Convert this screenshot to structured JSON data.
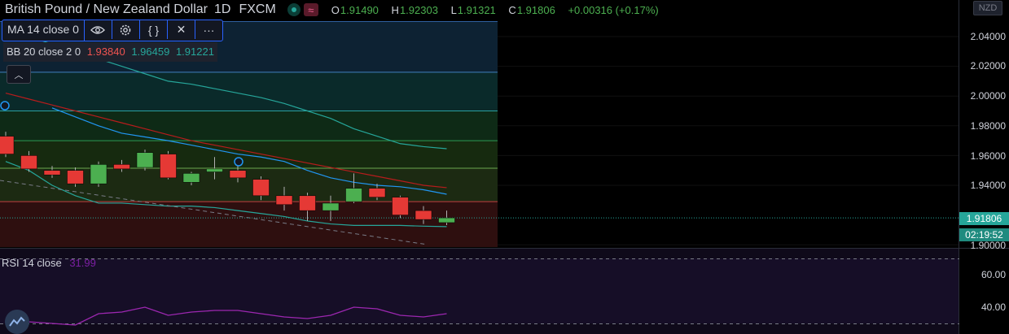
{
  "header": {
    "symbol": "British Pound / New Zealand Dollar",
    "timeframe": "1D",
    "exchange": "FXCM",
    "open_key": "O",
    "open": "1.91490",
    "high_key": "H",
    "high": "1.92303",
    "low_key": "L",
    "low": "1.91321",
    "close_key": "C",
    "close": "1.91806",
    "change": "+0.00316 (+0.17%)"
  },
  "indicators": {
    "ma_label": "MA 14 close 0",
    "bb_label": "BB 20 close 2 0",
    "bb_basis": "1.93840",
    "bb_upper": "1.96459",
    "bb_lower": "1.91221",
    "rsi_label": "RSI 14 close",
    "rsi_value": "31.99"
  },
  "toolbar_icons": [
    "eye-icon",
    "gear-icon",
    "braces-icon",
    "close-icon",
    "more-icon"
  ],
  "currency": "NZD",
  "price_axis": [
    "2.04000",
    "2.02000",
    "2.00000",
    "1.98000",
    "1.96000",
    "1.94000",
    "1.90000"
  ],
  "current_price": "1.91806",
  "countdown": "02:19:52",
  "rsi_axis": [
    "60.00",
    "40.00"
  ],
  "colors": {
    "up": "#4caf50",
    "down": "#e53935",
    "accent": "#2962ff",
    "ma": "#2196f3",
    "bb_basis": "#b71c1c",
    "bb_band": "#26a69a",
    "rsi": "#9c27b0"
  },
  "chart_data": {
    "type": "candlestick",
    "ylim": [
      1.9,
      2.05
    ],
    "candles": [
      {
        "o": 1.973,
        "h": 1.976,
        "l": 1.959,
        "c": 1.961
      },
      {
        "o": 1.96,
        "h": 1.963,
        "l": 1.949,
        "c": 1.951
      },
      {
        "o": 1.95,
        "h": 1.953,
        "l": 1.945,
        "c": 1.947
      },
      {
        "o": 1.95,
        "h": 1.952,
        "l": 1.939,
        "c": 1.941
      },
      {
        "o": 1.941,
        "h": 1.956,
        "l": 1.939,
        "c": 1.954
      },
      {
        "o": 1.954,
        "h": 1.957,
        "l": 1.949,
        "c": 1.951
      },
      {
        "o": 1.952,
        "h": 1.964,
        "l": 1.95,
        "c": 1.962
      },
      {
        "o": 1.961,
        "h": 1.963,
        "l": 1.944,
        "c": 1.945
      },
      {
        "o": 1.942,
        "h": 1.949,
        "l": 1.94,
        "c": 1.948
      },
      {
        "o": 1.949,
        "h": 1.959,
        "l": 1.944,
        "c": 1.951
      },
      {
        "o": 1.95,
        "h": 1.953,
        "l": 1.942,
        "c": 1.945
      },
      {
        "o": 1.944,
        "h": 1.946,
        "l": 1.93,
        "c": 1.933
      },
      {
        "o": 1.933,
        "h": 1.939,
        "l": 1.923,
        "c": 1.927
      },
      {
        "o": 1.933,
        "h": 1.935,
        "l": 1.916,
        "c": 1.923
      },
      {
        "o": 1.923,
        "h": 1.933,
        "l": 1.916,
        "c": 1.928
      },
      {
        "o": 1.929,
        "h": 1.948,
        "l": 1.928,
        "c": 1.938
      },
      {
        "o": 1.938,
        "h": 1.941,
        "l": 1.93,
        "c": 1.932
      },
      {
        "o": 1.932,
        "h": 1.933,
        "l": 1.918,
        "c": 1.92
      },
      {
        "o": 1.923,
        "h": 1.926,
        "l": 1.914,
        "c": 1.917
      },
      {
        "o": 1.9149,
        "h": 1.923,
        "l": 1.9132,
        "c": 1.9181
      }
    ],
    "ma14": [
      1.992,
      1.986,
      1.98,
      1.975,
      1.9725,
      1.97,
      1.967,
      1.964,
      1.961,
      1.959,
      1.956,
      1.95,
      1.945,
      1.942,
      1.94,
      1.939,
      1.937,
      1.934
    ],
    "bb_basis_line": [
      2.002,
      1.998,
      1.994,
      1.99,
      1.986,
      1.982,
      1.978,
      1.974,
      1.97,
      1.967,
      1.964,
      1.961,
      1.958,
      1.955,
      1.952,
      1.949,
      1.946,
      1.943,
      1.94,
      1.9384
    ],
    "bb_upper_line": [
      2.045,
      2.04,
      2.035,
      2.03,
      2.025,
      2.02,
      2.015,
      2.01,
      2.008,
      2.005,
      2.002,
      1.999,
      1.995,
      1.99,
      1.985,
      1.978,
      1.973,
      1.968,
      1.966,
      1.9646
    ],
    "bb_lower_line": [
      1.956,
      1.95,
      1.94,
      1.933,
      1.928,
      1.928,
      1.927,
      1.926,
      1.926,
      1.925,
      1.923,
      1.921,
      1.919,
      1.916,
      1.914,
      1.913,
      1.913,
      1.913,
      1.9125,
      1.9122
    ],
    "rsi": [
      33,
      31,
      30,
      29,
      36,
      37,
      40,
      35,
      37,
      38,
      38,
      36,
      34,
      33,
      35,
      40,
      39,
      35,
      34,
      36
    ],
    "rsi_ylim": [
      28,
      74
    ],
    "fib_levels": [
      2.016,
      1.99,
      1.97,
      1.9515,
      1.929
    ]
  }
}
